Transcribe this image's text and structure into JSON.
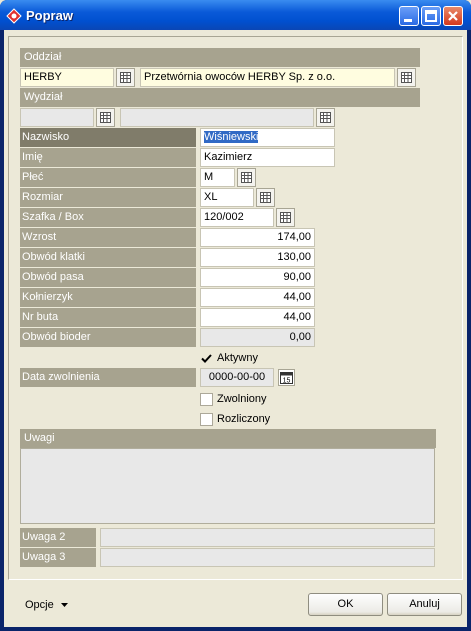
{
  "window": {
    "title": "Popraw"
  },
  "sections": {
    "oddzial": "Oddział",
    "wydzial": "Wydział",
    "uwagi": "Uwagi"
  },
  "oddzial": {
    "code": "HERBY",
    "name": "Przetwórnia owoców HERBY Sp. z o.o."
  },
  "wydzial": {
    "code": "",
    "name": ""
  },
  "fields": [
    {
      "label": "Nazwisko",
      "value": "Wiśniewski"
    },
    {
      "label": "Imię",
      "value": "Kazimierz"
    },
    {
      "label": "Płeć",
      "value": "M"
    },
    {
      "label": "Rozmiar",
      "value": "XL"
    },
    {
      "label": "Szafka / Box",
      "value": "120/002"
    },
    {
      "label": "Wzrost",
      "value": "174,00"
    },
    {
      "label": "Obwód klatki",
      "value": "130,00"
    },
    {
      "label": "Obwód pasa",
      "value": "90,00"
    },
    {
      "label": "Kołnierzyk",
      "value": "44,00"
    },
    {
      "label": "Nr buta",
      "value": "44,00"
    },
    {
      "label": "Obwód bioder",
      "value": "0,00"
    }
  ],
  "aktywny": {
    "label": "Aktywny",
    "checked": true
  },
  "data_zwolnienia": {
    "label": "Data zwolnienia",
    "value": "0000-00-00",
    "calendar_day": "15"
  },
  "zwolniony": {
    "label": "Zwolniony",
    "checked": false
  },
  "rozliczony": {
    "label": "Rozliczony",
    "checked": false
  },
  "uwagi": {
    "value": ""
  },
  "uwaga2": {
    "label": "Uwaga 2",
    "value": ""
  },
  "uwaga3": {
    "label": "Uwaga 3",
    "value": ""
  },
  "footer": {
    "options_label": "Opcje",
    "ok_label": "OK",
    "cancel_label": "Anuluj"
  },
  "colors": {
    "header_bg": "#a7a38f",
    "highlight_label_bg": "#807c6a",
    "yellow_field_bg": "#fffde0",
    "selection": "#316ac5"
  },
  "icons": [
    "app-icon",
    "minimize-icon",
    "maximize-icon",
    "close-icon",
    "lookup-grid-icon",
    "calendar-icon",
    "check-icon",
    "dropdown-arrow-icon"
  ]
}
